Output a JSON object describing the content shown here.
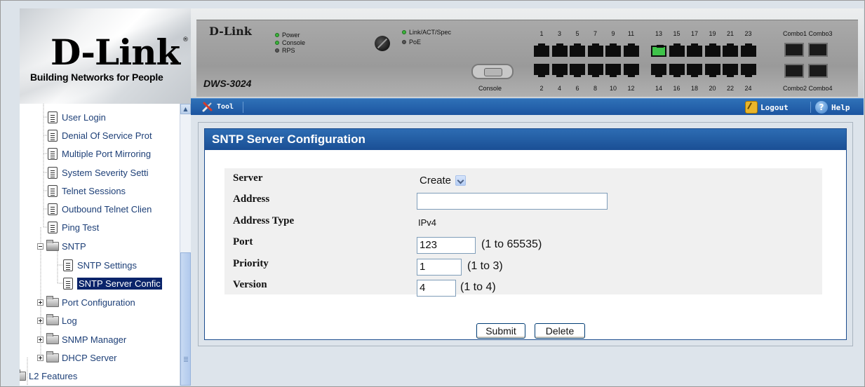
{
  "logo": {
    "brand": "D-Link",
    "registered_mark": "®",
    "tagline": "Building Networks for People"
  },
  "device": {
    "brand": "D-Link",
    "model": "DWS-3024",
    "leds": [
      {
        "label": "Power",
        "color": "green"
      },
      {
        "label": "Console",
        "color": "green"
      },
      {
        "label": "RPS",
        "color": "grey"
      },
      {
        "label": "Link/ACT/Spec",
        "color": "green"
      },
      {
        "label": "PoE",
        "color": "grey"
      }
    ],
    "console_label": "Console",
    "top_port_numbers": [
      "1",
      "3",
      "5",
      "7",
      "9",
      "11",
      "13",
      "15",
      "17",
      "19",
      "21",
      "23"
    ],
    "bottom_port_numbers": [
      "2",
      "4",
      "6",
      "8",
      "10",
      "12",
      "14",
      "16",
      "18",
      "20",
      "22",
      "24"
    ],
    "combo_top_label": "Combo1 Combo3",
    "combo_bottom_label": "Combo2 Combo4",
    "link_port": "13"
  },
  "toolbar": {
    "tool_label": "Tool",
    "logout_label": "Logout",
    "help_label": "Help"
  },
  "sidebar": {
    "items": [
      {
        "label": "User Login",
        "type": "doc"
      },
      {
        "label": "Denial Of Service Prot",
        "type": "doc"
      },
      {
        "label": "Multiple Port Mirroring",
        "type": "doc"
      },
      {
        "label": "System Severity Setti",
        "type": "doc"
      },
      {
        "label": "Telnet Sessions",
        "type": "doc"
      },
      {
        "label": "Outbound Telnet Clien",
        "type": "doc"
      },
      {
        "label": "Ping Test",
        "type": "doc"
      },
      {
        "label": "SNTP",
        "type": "folder-open"
      },
      {
        "label": "SNTP Settings",
        "type": "doc"
      },
      {
        "label": "SNTP Server Confic",
        "type": "doc",
        "selected": true
      },
      {
        "label": "Port Configuration",
        "type": "folder"
      },
      {
        "label": "Log",
        "type": "folder"
      },
      {
        "label": "SNMP Manager",
        "type": "folder"
      },
      {
        "label": "DHCP Server",
        "type": "folder"
      },
      {
        "label": "L2 Features",
        "type": "folder"
      }
    ]
  },
  "panel": {
    "title": "SNTP Server Configuration"
  },
  "form": {
    "server_label": "Server",
    "server_value": "Create",
    "address_label": "Address",
    "address_value": "",
    "address_type_label": "Address Type",
    "address_type_value": "IPv4",
    "port_label": "Port",
    "port_value": "123",
    "port_hint": "(1 to 65535)",
    "priority_label": "Priority",
    "priority_value": "1",
    "priority_hint": "(1 to 3)",
    "version_label": "Version",
    "version_value": "4",
    "version_hint": "(1 to 4)",
    "submit_label": "Submit",
    "delete_label": "Delete"
  }
}
